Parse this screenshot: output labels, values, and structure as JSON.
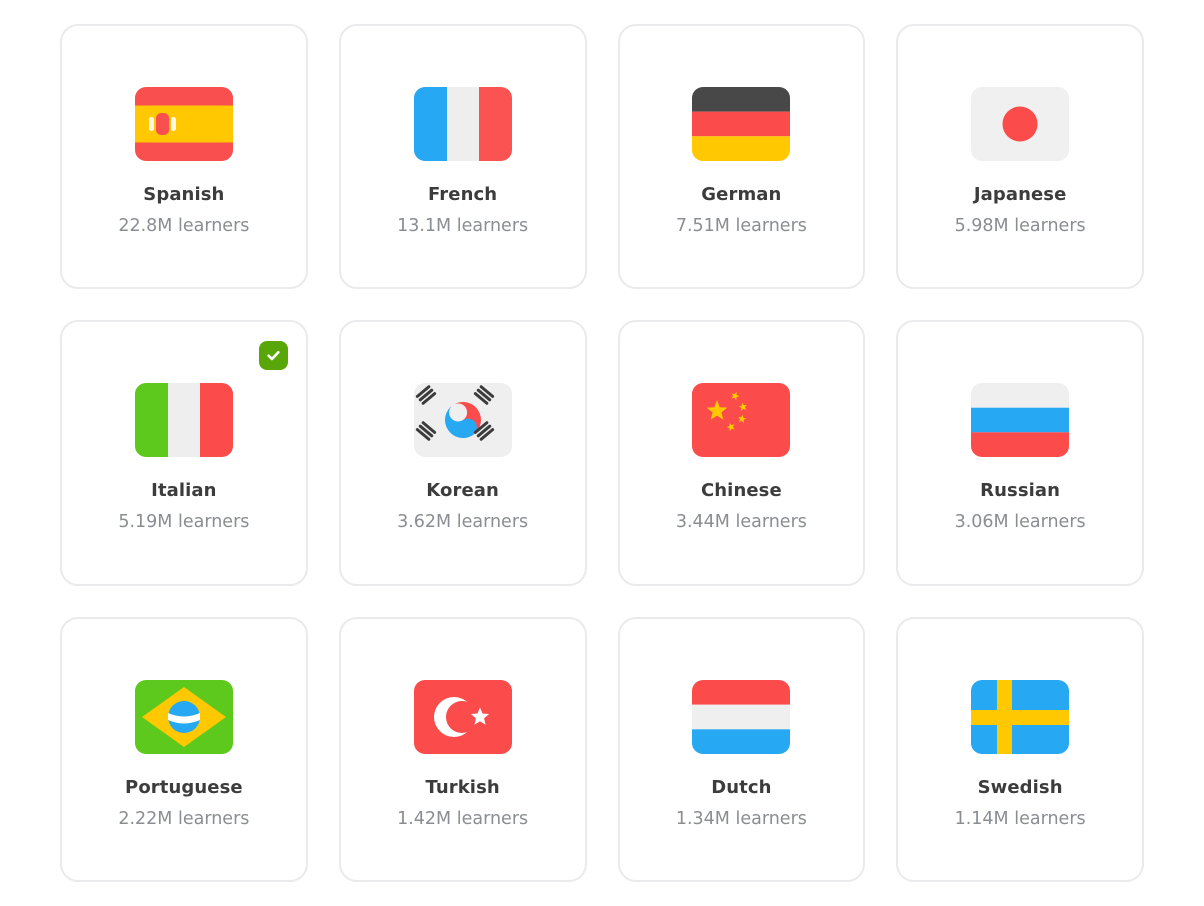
{
  "grid": {
    "columns": 4,
    "rows": 3,
    "background": "#ffffff",
    "card_border_color": "#e9eaec",
    "name_color": "#3c3c3c",
    "learners_color": "#8a8d91",
    "badge_color": "#58a608",
    "badge_icon": "check-icon",
    "learners_suffix": "learners"
  },
  "cards": [
    {
      "id": "spanish",
      "name": "Spanish",
      "learners": "22.8M learners",
      "flag_icon": "flag-spain-icon",
      "selected": false,
      "flag_colors": [
        "#f94f4f",
        "#ffc800",
        "#f94f4f"
      ]
    },
    {
      "id": "french",
      "name": "French",
      "learners": "13.1M learners",
      "flag_icon": "flag-france-icon",
      "selected": false,
      "flag_colors": [
        "#26a8f2",
        "#eeeeee",
        "#fb5252"
      ]
    },
    {
      "id": "german",
      "name": "German",
      "learners": "7.51M learners",
      "flag_icon": "flag-germany-icon",
      "selected": false,
      "flag_colors": [
        "#484848",
        "#fb4b4b",
        "#ffc800"
      ]
    },
    {
      "id": "japanese",
      "name": "Japanese",
      "learners": "5.98M learners",
      "flag_icon": "flag-japan-icon",
      "selected": false,
      "flag_colors": [
        "#f0f0f0",
        "#fb4b4b"
      ]
    },
    {
      "id": "italian",
      "name": "Italian",
      "learners": "5.19M learners",
      "flag_icon": "flag-italy-icon",
      "selected": true,
      "flag_colors": [
        "#5cc91c",
        "#eeeeee",
        "#fb4b4b"
      ]
    },
    {
      "id": "korean",
      "name": "Korean",
      "learners": "3.62M learners",
      "flag_icon": "flag-south-korea-icon",
      "selected": false,
      "flag_colors": [
        "#efefef",
        "#fb4b4b",
        "#26a8f2",
        "#3c3c3c"
      ]
    },
    {
      "id": "chinese",
      "name": "Chinese",
      "learners": "3.44M learners",
      "flag_icon": "flag-china-icon",
      "selected": false,
      "flag_colors": [
        "#fb4b4b",
        "#ffc800"
      ]
    },
    {
      "id": "russian",
      "name": "Russian",
      "learners": "3.06M learners",
      "flag_icon": "flag-russia-icon",
      "selected": false,
      "flag_colors": [
        "#efefef",
        "#26a8f2",
        "#fb4b4b"
      ]
    },
    {
      "id": "portuguese",
      "name": "Portuguese",
      "learners": "2.22M learners",
      "flag_icon": "flag-brazil-icon",
      "selected": false,
      "flag_colors": [
        "#5cc91c",
        "#ffc800",
        "#26a8f2",
        "#ffffff"
      ]
    },
    {
      "id": "turkish",
      "name": "Turkish",
      "learners": "1.42M learners",
      "flag_icon": "flag-turkey-icon",
      "selected": false,
      "flag_colors": [
        "#fb4b4b",
        "#ffffff"
      ]
    },
    {
      "id": "dutch",
      "name": "Dutch",
      "learners": "1.34M learners",
      "flag_icon": "flag-netherlands-icon",
      "selected": false,
      "flag_colors": [
        "#fb4b4b",
        "#efefef",
        "#26a8f2"
      ]
    },
    {
      "id": "swedish",
      "name": "Swedish",
      "learners": "1.14M learners",
      "flag_icon": "flag-sweden-icon",
      "selected": false,
      "flag_colors": [
        "#26a8f2",
        "#ffc800"
      ]
    }
  ]
}
